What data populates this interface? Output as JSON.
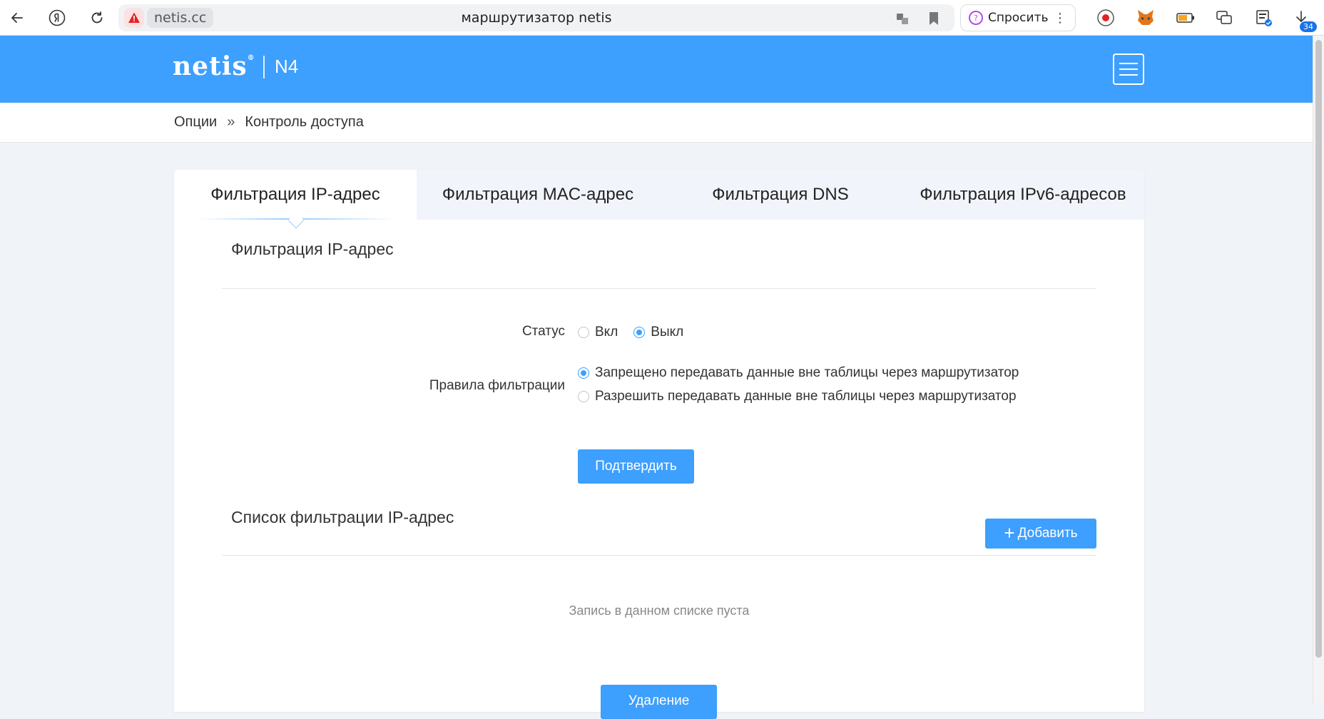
{
  "browser": {
    "domain": "netis.cc",
    "tab_title": "маршрутизатор netis",
    "ask_label": "Спросить",
    "downloads_count": "34"
  },
  "header": {
    "logo": "netis",
    "logo_mark": "®",
    "model": "N4"
  },
  "breadcrumb": {
    "root": "Опции",
    "separator": "»",
    "current": "Контроль доступа"
  },
  "tabs": [
    {
      "label": "Фильтрация IP-адрес",
      "active": true
    },
    {
      "label": "Фильтрация MAC-адрес",
      "active": false
    },
    {
      "label": "Фильтрация DNS",
      "active": false
    },
    {
      "label": "Фильтрация IPv6-адресов",
      "active": false
    }
  ],
  "filter_section": {
    "title": "Фильтрация IP-адрес",
    "status_label": "Статус",
    "status_options": [
      {
        "label": "Вкл",
        "checked": false
      },
      {
        "label": "Выкл",
        "checked": true
      }
    ],
    "rules_label": "Правила фильтрации",
    "rules_options": [
      {
        "label": "Запрещено передавать данные вне таблицы через маршрутизатор",
        "checked": true
      },
      {
        "label": "Разрешить передавать данные вне таблицы через маршрутизатор",
        "checked": false
      }
    ],
    "confirm_label": "Подтвердить"
  },
  "list_section": {
    "title": "Список фильтрации IP-адрес",
    "add_label": "Добавить",
    "empty_text": "Запись в данном списке пуста",
    "delete_label": "Удаление"
  },
  "colors": {
    "accent": "#3d9ffe",
    "background": "#f0f3f7"
  }
}
